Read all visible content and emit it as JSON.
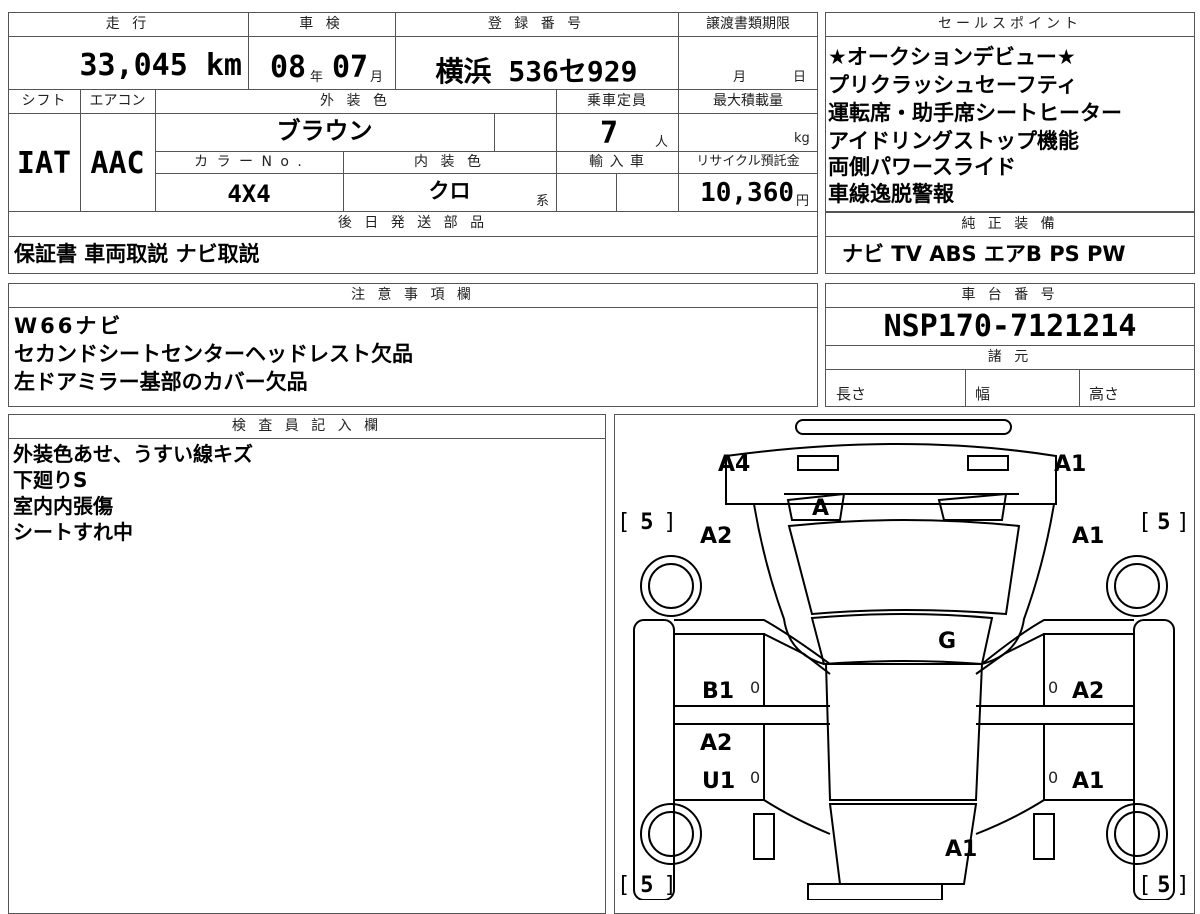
{
  "headers": {
    "mileage": "走 行",
    "inspection": "車 検",
    "registration": "登 録 番 号",
    "transfer_deadline": "譲渡書類期限",
    "sales_points": "セールスポイント",
    "shift": "シフト",
    "aircon": "エアコン",
    "exterior_color": "外 装 色",
    "capacity": "乗車定員",
    "max_load": "最大積載量",
    "color_no": "カ ラ ー N o .",
    "interior_color": "内 装 色",
    "import": "輸 入 車",
    "recycle_fee": "リサイクル預託金",
    "later_parts": "後 日 発 送 部 品",
    "factory_equipment": "純 正 装 備",
    "notes": "注 意 事 項 欄",
    "chassis_no": "車 台 番 号",
    "specs": "諸 元",
    "inspector": "検 査 員 記 入 欄"
  },
  "values": {
    "mileage": "33,045 km",
    "inspection_year": "08",
    "inspection_year_unit": "年",
    "inspection_month": "07",
    "inspection_month_unit": "月",
    "registration": "横浜 536セ929",
    "transfer_month_unit": "月",
    "transfer_day_unit": "日",
    "shift": "IAT",
    "aircon": "AAC",
    "exterior_color": "ブラウン",
    "capacity": "7",
    "capacity_unit": "人",
    "max_load_unit": "kg",
    "color_no": "4X4",
    "interior_color": "クロ",
    "interior_suffix": "系",
    "recycle_fee": "10,360",
    "recycle_unit": "円",
    "later_parts": "保証書 車両取説 ナビ取説",
    "factory_equipment": "ナビ TV ABS エアB PS PW",
    "chassis_no": "NSP170-7121214",
    "spec_length": "長さ",
    "spec_width": "幅",
    "spec_height": "高さ"
  },
  "sales_points": [
    "★オークションデビュー★",
    "プリクラッシュセーフティ",
    "運転席・助手席シートヒーター",
    "アイドリングストップ機能",
    "両側パワースライド",
    "車線逸脱警報"
  ],
  "notes": [
    "W66ナビ",
    "セカンドシートセンターヘッドレスト欠品",
    "左ドアミラー基部のカバー欠品"
  ],
  "inspector_notes": [
    "外装色あせ、うすい線キズ",
    "下廻りS",
    "室内内張傷",
    "シートすれ中"
  ],
  "diagram_labels": {
    "front_left": "A4",
    "front_right": "A1",
    "windshield": "A",
    "left_front_fender": "A2",
    "right_front_fender": "A1",
    "roof": "G",
    "left_front_door": "B1",
    "right_front_door": "A2",
    "left_rear_door_top": "A2",
    "left_rear_door": "U1",
    "right_rear_door": "A1",
    "rear": "A1",
    "tire_fl": "5",
    "tire_fr": "5",
    "tire_rl": "5",
    "tire_rr": "5",
    "zero": "0"
  }
}
